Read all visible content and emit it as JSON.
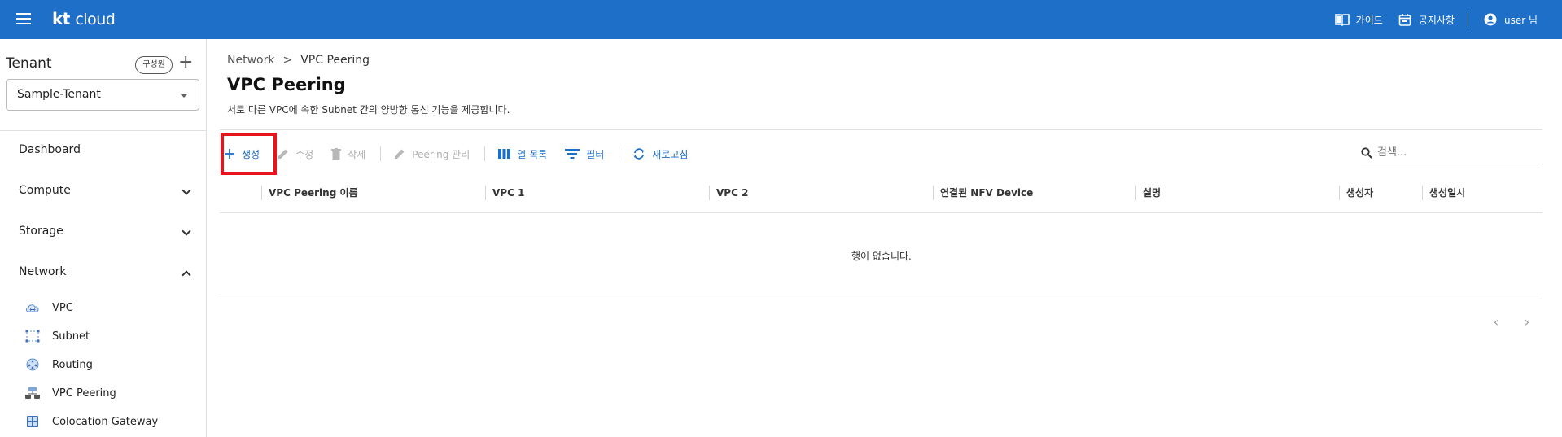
{
  "header": {
    "logo_kt": "kt",
    "logo_cloud": "cloud",
    "links": [
      {
        "label": "가이드",
        "icon": "book-icon"
      },
      {
        "label": "공지사항",
        "icon": "calendar-icon"
      },
      {
        "label": "user 님",
        "icon": "account-icon"
      }
    ]
  },
  "sidebar": {
    "tenant_title": "Tenant",
    "member_button": "구성원",
    "add_button": "+",
    "tenant_selected": "Sample-Tenant",
    "nav": [
      {
        "label": "Dashboard",
        "expandable": false
      },
      {
        "label": "Compute",
        "expandable": true,
        "expanded": false
      },
      {
        "label": "Storage",
        "expandable": true,
        "expanded": false
      },
      {
        "label": "Network",
        "expandable": true,
        "expanded": true
      }
    ],
    "network_items": [
      {
        "label": "VPC",
        "icon": "vpc-cloud-icon"
      },
      {
        "label": "Subnet",
        "icon": "subnet-icon"
      },
      {
        "label": "Routing",
        "icon": "routing-icon"
      },
      {
        "label": "VPC Peering",
        "icon": "vpc-peering-icon"
      },
      {
        "label": "Colocation Gateway",
        "icon": "colocation-gateway-icon"
      }
    ]
  },
  "breadcrumb": {
    "parent": "Network",
    "separator": ">",
    "current": "VPC Peering"
  },
  "page": {
    "title": "VPC Peering",
    "description": "서로 다른 VPC에 속한 Subnet 간의 양방향 통신 기능을 제공합니다."
  },
  "toolbar": {
    "create": "생성",
    "edit": "수정",
    "delete": "삭제",
    "peering_manage": "Peering 관리",
    "columns": "열 목록",
    "filter": "필터",
    "refresh": "새로고침"
  },
  "search": {
    "placeholder": "검색..."
  },
  "table": {
    "columns": [
      "VPC Peering 이름",
      "VPC 1",
      "VPC 2",
      "연결된 NFV Device",
      "설명",
      "생성자",
      "생성일시"
    ],
    "empty_message": "행이 없습니다."
  },
  "colors": {
    "header_bg": "#1e6fc8",
    "accent": "#1e6fc8",
    "highlight": "#e8141b"
  }
}
